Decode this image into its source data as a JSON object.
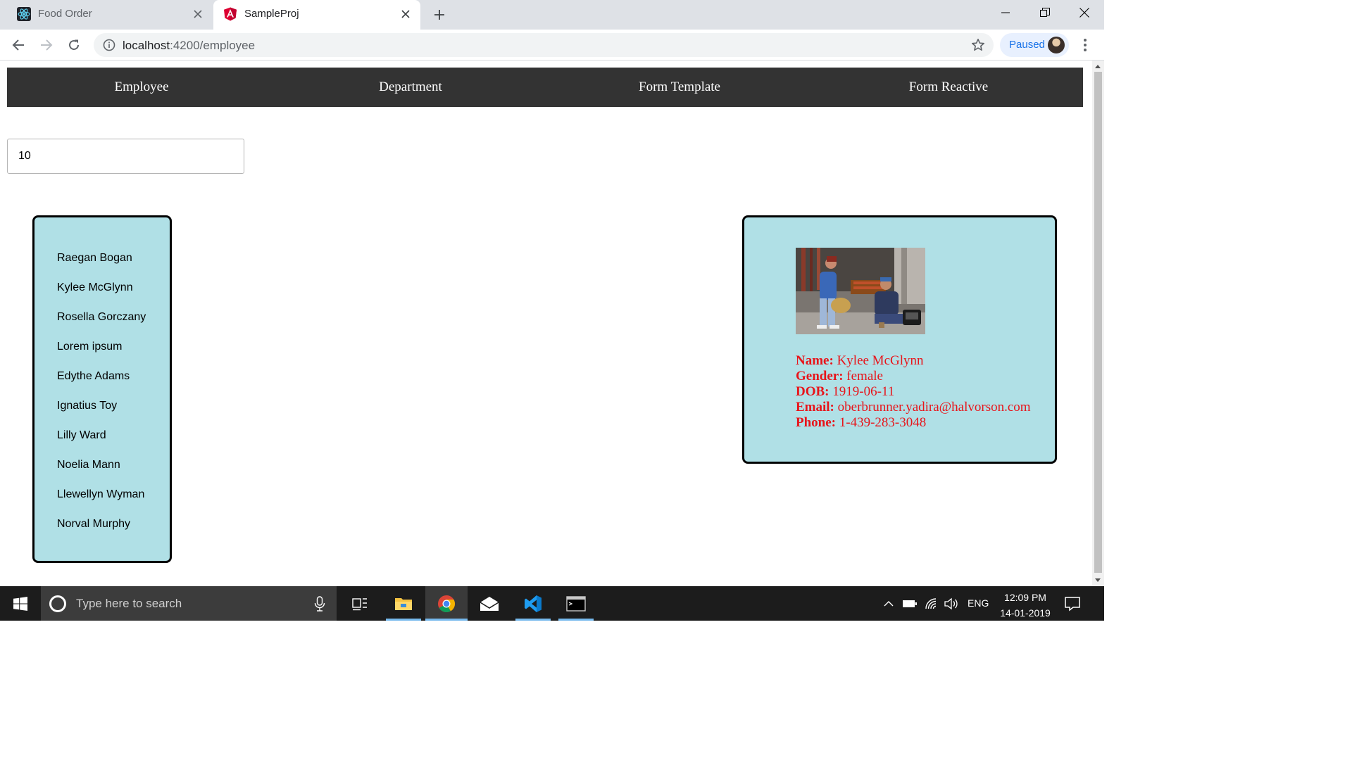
{
  "browser": {
    "tabs": [
      {
        "title": "Food Order"
      },
      {
        "title": "SampleProj"
      }
    ],
    "url_host": "localhost",
    "url_path": ":4200/employee",
    "profile_label": "Paused"
  },
  "app": {
    "nav": [
      "Employee",
      "Department",
      "Form Template",
      "Form Reactive"
    ],
    "count_value": "10",
    "employees": [
      "Raegan Bogan",
      "Kylee McGlynn",
      "Rosella Gorczany",
      "Lorem ipsum",
      "Edythe Adams",
      "Ignatius Toy",
      "Lilly Ward",
      "Noelia Mann",
      "Llewellyn Wyman",
      "Norval Murphy"
    ],
    "detail": {
      "name_label": "Name:",
      "name": "Kylee McGlynn",
      "gender_label": "Gender:",
      "gender": "female",
      "dob_label": "DOB:",
      "dob": "1919-06-11",
      "email_label": "Email:",
      "email": "oberbrunner.yadira@halvorson.com",
      "phone_label": "Phone:",
      "phone": "1-439-283-3048"
    }
  },
  "taskbar": {
    "search_placeholder": "Type here to search",
    "lang": "ENG",
    "time": "12:09 PM",
    "date": "14-01-2019"
  },
  "colors": {
    "nav_bg": "#333333",
    "panel_bg": "#b0e0e6",
    "detail_text": "#e8141a"
  },
  "icons": {
    "tab1_favicon": "react-icon",
    "tab2_favicon": "angular-icon",
    "photo": "employee-photo"
  }
}
